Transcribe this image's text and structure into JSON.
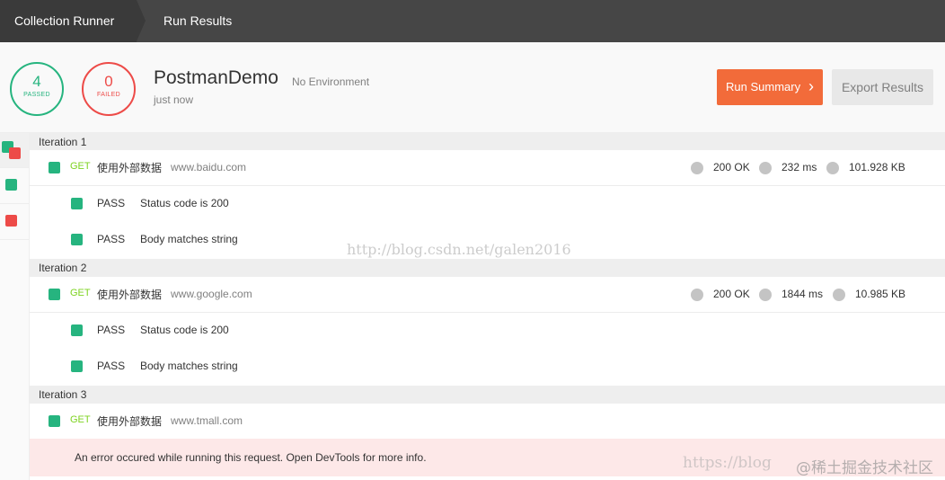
{
  "breadcrumb": {
    "items": [
      {
        "label": "Collection Runner"
      },
      {
        "label": "Run Results"
      }
    ]
  },
  "summary": {
    "passed_count": "4",
    "passed_label": "PASSED",
    "failed_count": "0",
    "failed_label": "FAILED",
    "collection_name": "PostmanDemo",
    "environment": "No Environment",
    "run_time": "just now",
    "run_summary_label": "Run Summary",
    "export_label": "Export Results"
  },
  "colors": {
    "pass": "#26b47f",
    "fail": "#ed4b48",
    "accent": "#f26b3a",
    "method_get": "#7ed321",
    "error_bg": "#fde8e8"
  },
  "iterations": [
    {
      "title": "Iteration 1",
      "request": {
        "method": "GET",
        "name": "使用外部数据",
        "url": "www.baidu.com",
        "status": "200 OK",
        "time": "232 ms",
        "size": "101.928 KB"
      },
      "tests": [
        {
          "status": "PASS",
          "name": "Status code is 200"
        },
        {
          "status": "PASS",
          "name": "Body matches string"
        }
      ]
    },
    {
      "title": "Iteration 2",
      "request": {
        "method": "GET",
        "name": "使用外部数据",
        "url": "www.google.com",
        "status": "200 OK",
        "time": "1844 ms",
        "size": "10.985 KB"
      },
      "tests": [
        {
          "status": "PASS",
          "name": "Status code is 200"
        },
        {
          "status": "PASS",
          "name": "Body matches string"
        }
      ]
    },
    {
      "title": "Iteration 3",
      "request": {
        "method": "GET",
        "name": "使用外部数据",
        "url": "www.tmall.com"
      },
      "error": "An error occured while running this request. Open DevTools for more info."
    }
  ],
  "watermarks": {
    "center": "http://blog.csdn.net/galen2016",
    "bottom_url": "https://blog",
    "bottom_site": "@稀土掘金技术社区"
  }
}
